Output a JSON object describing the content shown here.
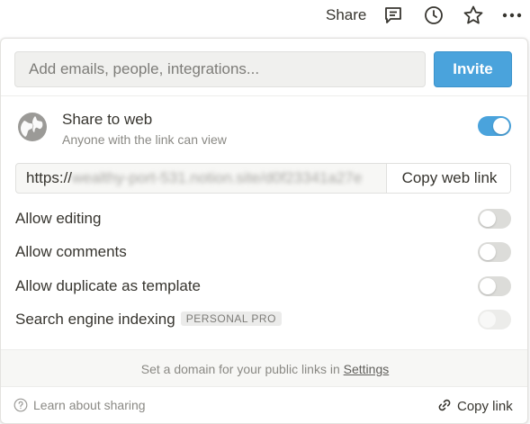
{
  "topbar": {
    "share_label": "Share",
    "icons": [
      "comment-icon",
      "clock-icon",
      "star-icon",
      "more-icon"
    ]
  },
  "invite": {
    "placeholder": "Add emails, people, integrations...",
    "button_label": "Invite"
  },
  "share_web": {
    "title": "Share to web",
    "subtitle": "Anyone with the link can view",
    "enabled": true,
    "url_prefix": "https://",
    "url_blurred": "wealthy-port-531.notion.site/d0f23341a27e",
    "copy_button_label": "Copy web link"
  },
  "options": [
    {
      "label": "Allow editing",
      "enabled": false
    },
    {
      "label": "Allow comments",
      "enabled": false
    },
    {
      "label": "Allow duplicate as template",
      "enabled": false
    },
    {
      "label": "Search engine indexing",
      "badge": "PERSONAL PRO",
      "enabled": false,
      "disabled": true
    }
  ],
  "domain": {
    "text": "Set a domain for your public links in",
    "link": "Settings"
  },
  "footer": {
    "learn_label": "Learn about sharing",
    "copy_link_label": "Copy link"
  },
  "colors": {
    "accent": "#4aa3dc",
    "text": "#37352f",
    "muted": "#8a8984"
  }
}
